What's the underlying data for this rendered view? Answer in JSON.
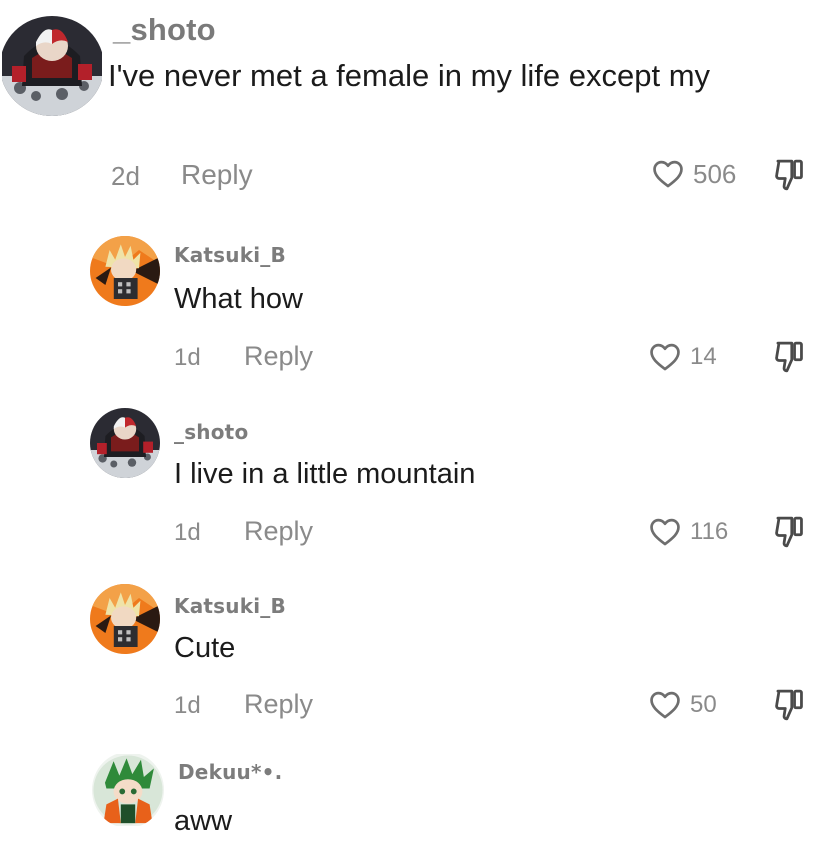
{
  "comments": [
    {
      "username": "_shoto",
      "text": "I've never met a female in my life except my",
      "time": "2d",
      "reply_label": "Reply",
      "likes": "506",
      "avatar": "shoto-avatar"
    },
    {
      "username": "Katsuki_B",
      "text": "What how",
      "time": "1d",
      "reply_label": "Reply",
      "likes": "14",
      "avatar": "katsuki-avatar"
    },
    {
      "username": "_shoto",
      "text": "I live in a little mountain",
      "time": "1d",
      "reply_label": "Reply",
      "likes": "116",
      "avatar": "shoto-avatar"
    },
    {
      "username": "Katsuki_B",
      "text": "Cute",
      "time": "1d",
      "reply_label": "Reply",
      "likes": "50",
      "avatar": "katsuki-avatar"
    },
    {
      "username": "Dekuu*•.",
      "text": "aww",
      "avatar": "deku-avatar"
    }
  ],
  "icons": {
    "like": "heart-outline-icon",
    "dislike": "thumbs-down-outline-icon"
  },
  "colors": {
    "background": "#ffffff",
    "username": "#7c7c7c",
    "text": "#1b1b1b",
    "meta": "#8a8a8a"
  }
}
